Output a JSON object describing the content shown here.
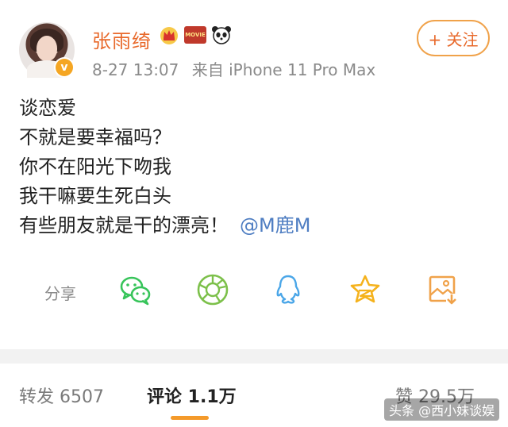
{
  "post": {
    "author": "张雨绮",
    "badges": [
      "crown-badge",
      "movie-badge",
      "panda-badge"
    ],
    "movie_badge_text": "MOVIE",
    "time": "8-27 13:07",
    "source": "来自 iPhone 11 Pro Max",
    "follow_label": "+ 关注",
    "content_lines": [
      "谈恋爱",
      "不就是要幸福吗？",
      "你不在阳光下吻我",
      "我干嘛要生死白头",
      "有些朋友就是干的漂亮！"
    ],
    "mention": "@M鹿M"
  },
  "share": {
    "label": "分享",
    "icons": [
      "wechat-icon",
      "moments-icon",
      "qq-icon",
      "qzone-icon",
      "save-image-icon"
    ]
  },
  "tabs": {
    "repost": "转发 6507",
    "comment": "评论 1.1万",
    "like": "赞 29.5万"
  },
  "watermark": "头条 @西小妹谈娱",
  "colors": {
    "accent": "#e8692b",
    "link": "#4f7ec2",
    "share_green": "#37c45a",
    "share_blue": "#4aa6e8",
    "share_yellow": "#f5b21c",
    "tab_underline": "#f49a2a"
  }
}
